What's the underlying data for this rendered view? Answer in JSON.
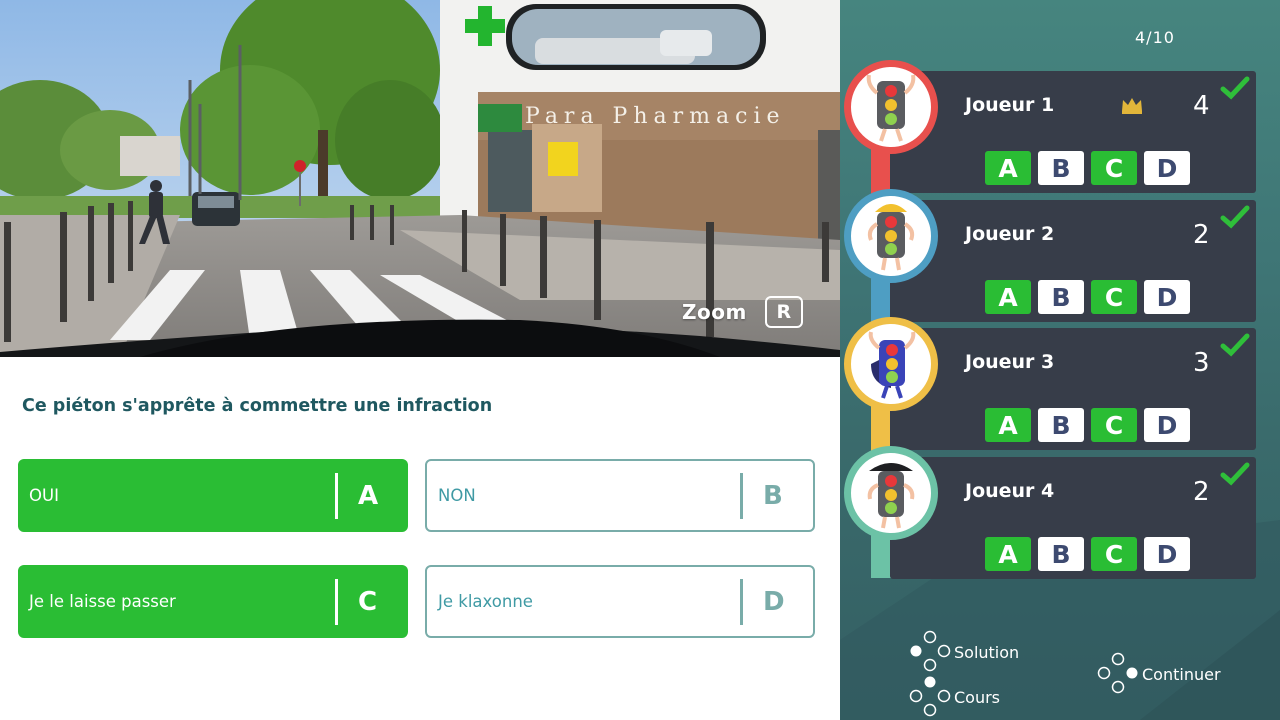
{
  "photo": {
    "zoom_label": "Zoom",
    "zoom_key": "R",
    "shop_sign": "Para Pharmacie"
  },
  "question": {
    "text": "Ce piéton s'apprête à commettre une infraction"
  },
  "answers": [
    {
      "text": "OUI",
      "letter": "A",
      "selected": true
    },
    {
      "text": "NON",
      "letter": "B",
      "selected": false
    },
    {
      "text": "Je le laisse passer",
      "letter": "C",
      "selected": true
    },
    {
      "text": "Je klaxonne",
      "letter": "D",
      "selected": false
    }
  ],
  "progress": {
    "label": "4/10"
  },
  "players": [
    {
      "name": "Joueur 1",
      "score": "4",
      "leader": true,
      "accent": "#e8504d",
      "votes": [
        {
          "letter": "A",
          "on": true
        },
        {
          "letter": "B",
          "on": false
        },
        {
          "letter": "C",
          "on": true
        },
        {
          "letter": "D",
          "on": false
        }
      ]
    },
    {
      "name": "Joueur 2",
      "score": "2",
      "leader": false,
      "accent": "#4e9ec3",
      "votes": [
        {
          "letter": "A",
          "on": true
        },
        {
          "letter": "B",
          "on": false
        },
        {
          "letter": "C",
          "on": true
        },
        {
          "letter": "D",
          "on": false
        }
      ]
    },
    {
      "name": "Joueur 3",
      "score": "3",
      "leader": false,
      "accent": "#efbf47",
      "votes": [
        {
          "letter": "A",
          "on": true
        },
        {
          "letter": "B",
          "on": false
        },
        {
          "letter": "C",
          "on": true
        },
        {
          "letter": "D",
          "on": false
        }
      ]
    },
    {
      "name": "Joueur 4",
      "score": "2",
      "leader": false,
      "accent": "#6cc2a6",
      "votes": [
        {
          "letter": "A",
          "on": true
        },
        {
          "letter": "B",
          "on": false
        },
        {
          "letter": "C",
          "on": true
        },
        {
          "letter": "D",
          "on": false
        }
      ]
    }
  ],
  "controls": {
    "solution_label": "Solution",
    "cours_label": "Cours",
    "continuer_label": "Continuer"
  },
  "colors": {
    "correct_green": "#2abd34",
    "answer_outline": "#79aca9",
    "card_bg": "#373d49",
    "panel_bg": "#3f7676"
  },
  "icons": [
    "crown-icon",
    "check-icon",
    "gamepad-left-dot-icon",
    "gamepad-bottom-dot-icon",
    "gamepad-right-dot-icon",
    "traffic-light-avatar-icon",
    "pharmacy-cross-icon"
  ]
}
